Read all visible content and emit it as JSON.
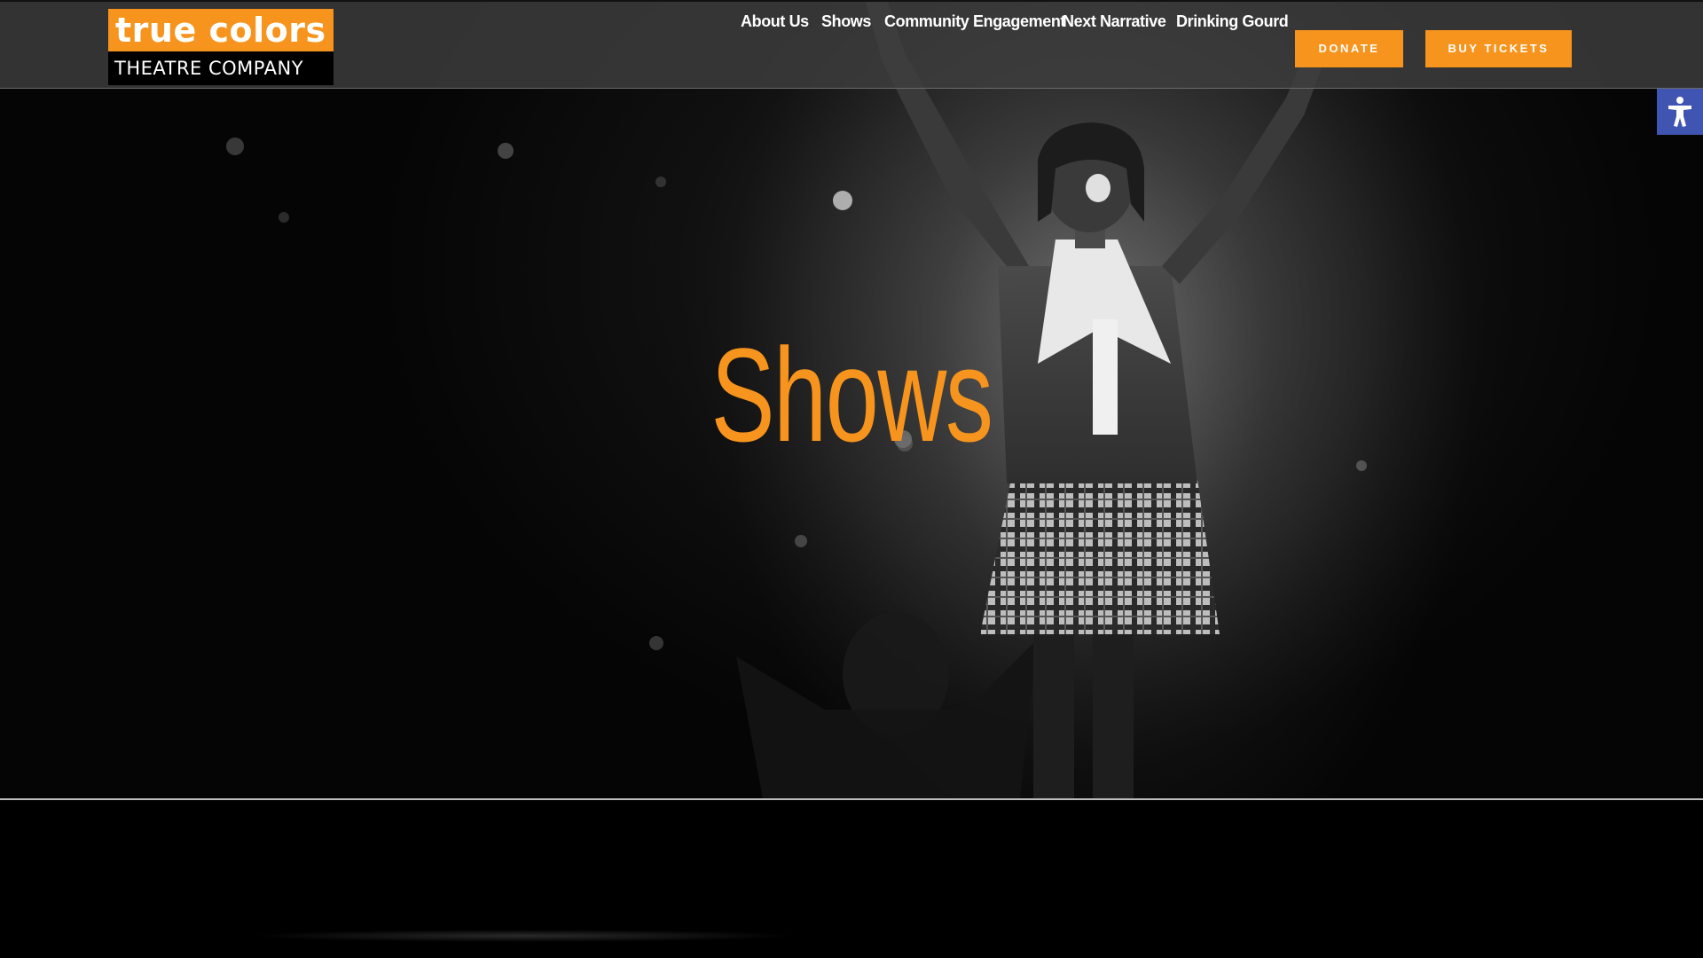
{
  "logo": {
    "line1": "true colors",
    "line2": "THEATRE COMPANY"
  },
  "nav": {
    "items": [
      {
        "label": "About Us"
      },
      {
        "label": "Shows"
      },
      {
        "label": "Community Engagement"
      },
      {
        "label": "Next Narrative"
      },
      {
        "label": "Drinking Gourd"
      }
    ],
    "donate_label": "DONATE",
    "tickets_label": "BUY TICKETS"
  },
  "hero": {
    "title": "Shows",
    "image": "black-and-white stage photo of performer with raised arms"
  },
  "accessibility": {
    "icon": "accessibility-icon"
  },
  "colors": {
    "accent": "#f7941d",
    "header_bg": "#3e3e3e",
    "accessibility_bg": "#4054b2",
    "page_bg": "#000000"
  }
}
